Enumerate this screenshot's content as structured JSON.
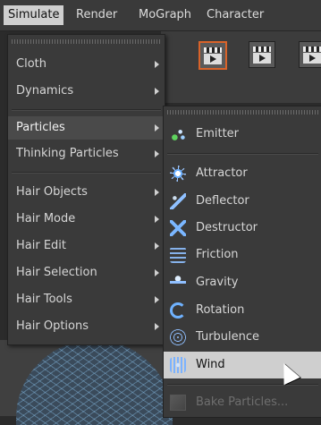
{
  "menubar": {
    "items": [
      {
        "label": "Simulate",
        "active": true
      },
      {
        "label": "Render",
        "active": false
      },
      {
        "label": "MoGraph",
        "active": false
      },
      {
        "label": "Character",
        "active": false
      }
    ]
  },
  "toolbar": {
    "icons": [
      "clapper-render-icon",
      "clapper-render-view-icon",
      "clapper-render-settings-icon"
    ]
  },
  "simulate_menu": {
    "items": [
      {
        "label": "Cloth",
        "has_submenu": true
      },
      {
        "label": "Dynamics",
        "has_submenu": true
      },
      {
        "label": "Particles",
        "has_submenu": true,
        "highlighted": true
      },
      {
        "label": "Thinking Particles",
        "has_submenu": true
      },
      {
        "label": "Hair Objects",
        "has_submenu": true
      },
      {
        "label": "Hair Mode",
        "has_submenu": true
      },
      {
        "label": "Hair Edit",
        "has_submenu": true
      },
      {
        "label": "Hair Selection",
        "has_submenu": true
      },
      {
        "label": "Hair Tools",
        "has_submenu": true
      },
      {
        "label": "Hair Options",
        "has_submenu": true
      }
    ]
  },
  "particles_submenu": {
    "items": [
      {
        "label": "Emitter",
        "icon": "emitter-icon"
      },
      {
        "label": "Attractor",
        "icon": "attractor-icon"
      },
      {
        "label": "Deflector",
        "icon": "deflector-icon"
      },
      {
        "label": "Destructor",
        "icon": "destructor-icon"
      },
      {
        "label": "Friction",
        "icon": "friction-icon"
      },
      {
        "label": "Gravity",
        "icon": "gravity-icon"
      },
      {
        "label": "Rotation",
        "icon": "rotation-icon"
      },
      {
        "label": "Turbulence",
        "icon": "turbulence-icon"
      },
      {
        "label": "Wind",
        "icon": "wind-icon",
        "highlighted": true
      },
      {
        "label": "Bake Particles...",
        "icon": "bake-particles-icon",
        "disabled": true
      }
    ]
  },
  "colors": {
    "menu_bg": "#3a3a3a",
    "highlight_light": "#cfcfcf",
    "highlight_dark": "#4a4a4a",
    "accent_orange": "#d9632a"
  }
}
